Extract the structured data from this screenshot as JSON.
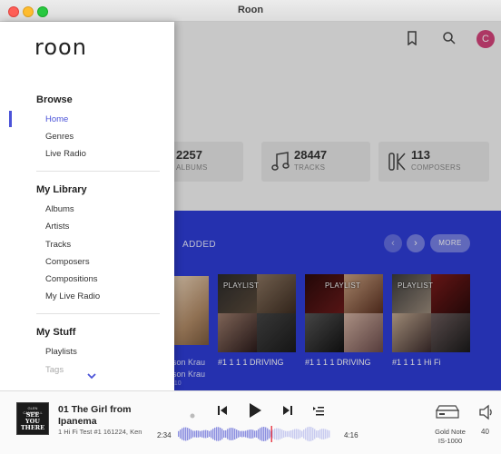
{
  "window": {
    "title": "Roon"
  },
  "header": {
    "avatar_letter": "C",
    "icons": [
      "bookmark-icon",
      "search-icon"
    ]
  },
  "stats": [
    {
      "value": "2257",
      "label": "ALBUMS",
      "icon": "album-icon"
    },
    {
      "value": "28447",
      "label": "TRACKS",
      "icon": "music-note-icon"
    },
    {
      "value": "113",
      "label": "COMPOSERS",
      "icon": "composer-icon"
    }
  ],
  "recent": {
    "tab_label": "ADDED",
    "more_label": "MORE",
    "partial_lines": [
      "ison Krau",
      "ison Krau",
      "/ 10"
    ],
    "cards": [
      {
        "tag": "PLAYLIST",
        "title": "#1 1 1 1 DRIVING"
      },
      {
        "tag": "PLAYLIST",
        "title": "#1 1 1 1  DRIVING"
      },
      {
        "tag": "PLAYLIST",
        "title": "#1 1 1 1 Hi Fi"
      }
    ]
  },
  "sidebar": {
    "logo": "roon",
    "browse": {
      "heading": "Browse",
      "items": [
        "Home",
        "Genres",
        "Live Radio"
      ]
    },
    "library": {
      "heading": "My Library",
      "items": [
        "Albums",
        "Artists",
        "Tracks",
        "Composers",
        "Compositions",
        "My Live Radio"
      ]
    },
    "stuff": {
      "heading": "My Stuff",
      "items": [
        "Playlists",
        "Tags"
      ]
    },
    "active_item": "Home"
  },
  "player": {
    "album_art_top": "GLEN CAMPBELL",
    "album_art_title": "SEE YOU THERE",
    "track_title": "01 The Girl from Ipanema",
    "track_subtitle": "1 Hi Fi Test #1 161224, Ken",
    "elapsed": "2:34",
    "duration": "4:16",
    "progress": 0.61,
    "device_line1": "Gold Note",
    "device_line2": "IS-1000",
    "volume": "40"
  },
  "colors": {
    "accent": "#4b53d8",
    "panel_blue": "#2e3cd6",
    "avatar": "#d4447a",
    "progress_marker": "#e8424e"
  }
}
